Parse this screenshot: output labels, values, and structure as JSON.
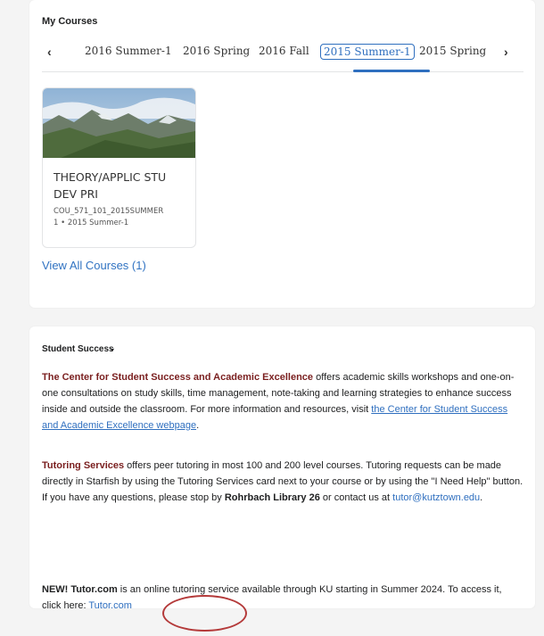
{
  "my_courses": {
    "title": "My Courses",
    "tabs": [
      "2016 Summer-1",
      "2016 Spring",
      "2016 Fall",
      "2015 Summer-1",
      "2015 Spring"
    ],
    "active_tab": "2015 Summer-1",
    "prev_glyph": "‹",
    "next_glyph": "›",
    "course": {
      "name": "THEORY/APPLIC STU DEV PRI",
      "code_line1": "COU_571_101_2015SUMMER",
      "code_line2": "1 • 2015 Summer-1"
    },
    "view_all": "View All Courses (1)"
  },
  "student_success": {
    "title": "Student Success",
    "chevron": "⌄",
    "p1": {
      "bold": "The Center for Student Success and Academic Excellence",
      "text": " offers academic skills workshops and one-on-one consultations on study skills, time management, note-taking and learning strategies to enhance success inside and outside the classroom. For more information and resources, visit ",
      "link": "the Center for Student Success and Academic Excellence webpage",
      "end": "."
    },
    "p2": {
      "bold": "Tutoring Services",
      "text1": " offers peer tutoring in most 100 and 200 level courses.  Tutoring requests can be made directly in Starfish by using the Tutoring Services card next to your course or by using the \"I Need Help\" button. If you have any questions, please stop by ",
      "bold2": "Rohrbach Library 26",
      "text2": " or contact us at ",
      "email": "tutor@kutztown.edu",
      "end": "."
    },
    "p3": {
      "bold": "NEW! Tutor.com",
      "text": " is an online tutoring service available through KU starting in Summer 2024. To access it, click here: ",
      "link": "Tutor.com"
    }
  },
  "colors": {
    "accent": "#2f6fbf",
    "maroon": "#7a1f1f",
    "annotation": "#b43a3a"
  }
}
